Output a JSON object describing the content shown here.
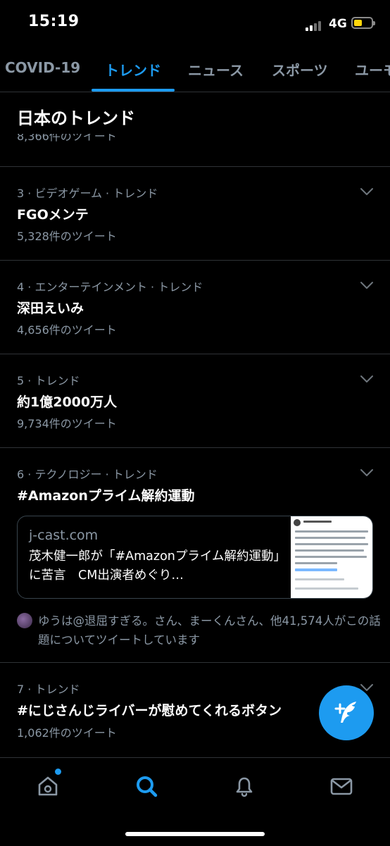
{
  "status_bar": {
    "time": "15:19",
    "network": "4G"
  },
  "tabs": [
    {
      "label": "COVID-19"
    },
    {
      "label": "トレンド"
    },
    {
      "label": "ニュース"
    },
    {
      "label": "スポーツ"
    },
    {
      "label": "ユーモ"
    }
  ],
  "section": {
    "title": "日本のトレンド",
    "cutoff_count": "8,366件のツイート"
  },
  "trends": [
    {
      "meta": "3 · ビデオゲーム · トレンド",
      "name": "FGOメンテ",
      "count": "5,328件のツイート"
    },
    {
      "meta": "4 · エンターテインメント · トレンド",
      "name": "深田えいみ",
      "count": "4,656件のツイート"
    },
    {
      "meta": "5 · トレンド",
      "name": "約1億2000万人",
      "count": "9,734件のツイート"
    },
    {
      "meta": "6 · テクノロジー · トレンド",
      "name": "#Amazonプライム解約運動"
    },
    {
      "meta": "7 · トレンド",
      "name": "#にじさんじライバーが慰めてくれるボタン",
      "count": "1,062件のツイート"
    }
  ],
  "link_card": {
    "domain": "j-cast.com",
    "title": "茂木健一郎が「#Amazonプライム解約運動」に苦言　CM出演者めぐり…"
  },
  "social_proof": {
    "text": "ゆうは@退屈すぎる。さん、まーくんさん、他41,574人がこの話題についてツイートしています"
  },
  "colors": {
    "accent": "#1d9bf0",
    "background": "#000000",
    "secondary_text": "#8b98a5",
    "divider": "#2f3336"
  },
  "icons": {
    "fab": "compose-feather-icon",
    "nav": [
      "home-icon",
      "search-icon",
      "notifications-bell-icon",
      "messages-envelope-icon"
    ],
    "active_nav": "search-icon"
  }
}
